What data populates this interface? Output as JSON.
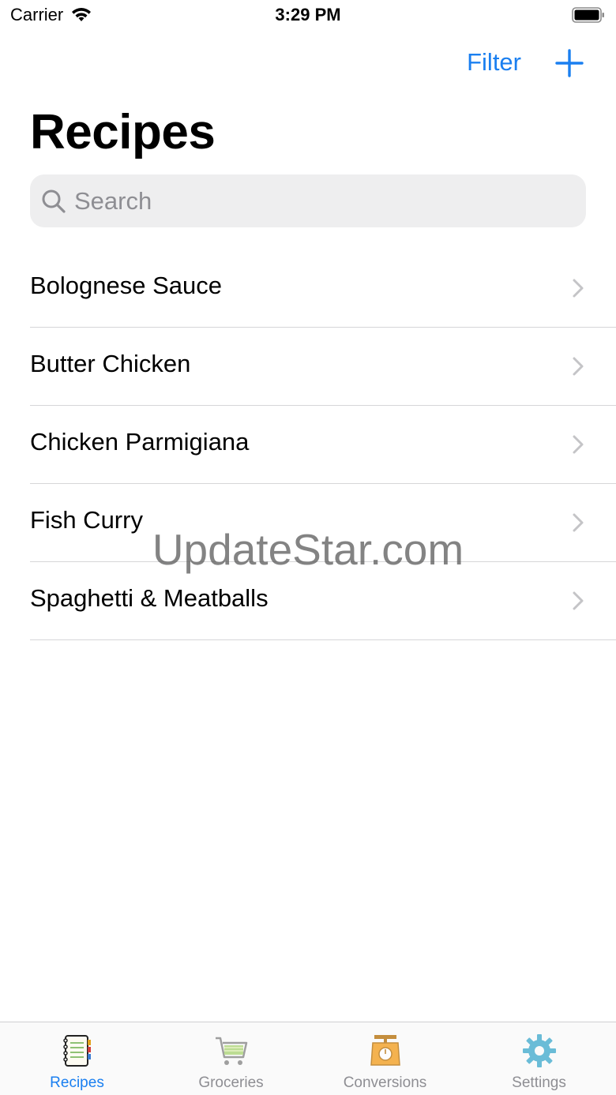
{
  "status_bar": {
    "carrier": "Carrier",
    "time": "3:29 PM"
  },
  "nav": {
    "filter_label": "Filter",
    "add_icon": "plus-icon"
  },
  "page": {
    "title": "Recipes"
  },
  "search": {
    "placeholder": "Search",
    "value": ""
  },
  "recipes": [
    {
      "name": "Bolognese Sauce"
    },
    {
      "name": "Butter Chicken"
    },
    {
      "name": "Chicken Parmigiana"
    },
    {
      "name": "Fish Curry"
    },
    {
      "name": "Spaghetti & Meatballs"
    }
  ],
  "watermark": "UpdateStar.com",
  "tabs": [
    {
      "label": "Recipes",
      "icon": "notebook-icon",
      "active": true
    },
    {
      "label": "Groceries",
      "icon": "cart-icon",
      "active": false
    },
    {
      "label": "Conversions",
      "icon": "scale-icon",
      "active": false
    },
    {
      "label": "Settings",
      "icon": "gear-icon",
      "active": false
    }
  ],
  "colors": {
    "accent": "#1a7ff0",
    "inactive_tab": "#8e8e93",
    "search_bg": "#eeeeef"
  }
}
